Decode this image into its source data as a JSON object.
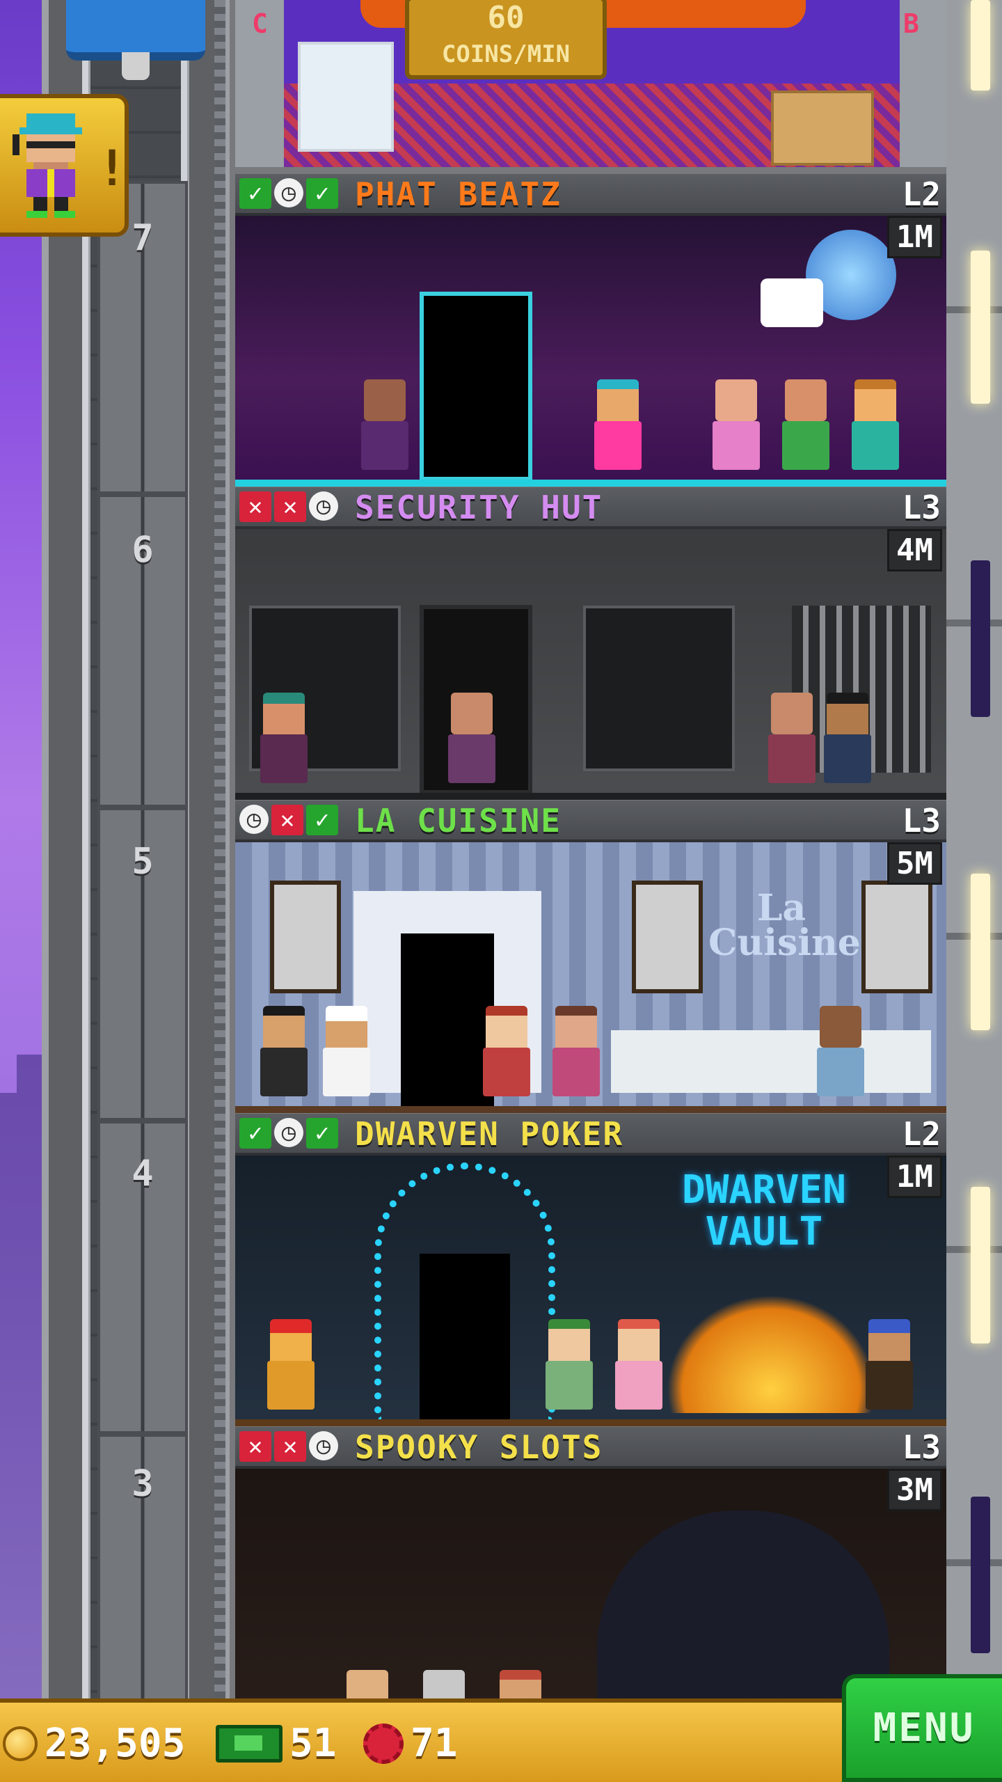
{
  "shaft": {
    "floor_numbers": [
      "7",
      "6",
      "5",
      "4",
      "3"
    ]
  },
  "top_floor": {
    "sign_value": "60",
    "sign_unit": "COINS/MIN",
    "corner_left": "C",
    "corner_right": "B"
  },
  "floors": [
    {
      "name": "PHAT BEATZ",
      "level": "L2",
      "population": "1M",
      "name_color": "#ff7a1a",
      "status": [
        "ok",
        "timer",
        "ok"
      ]
    },
    {
      "name": "SECURITY HUT",
      "level": "L3",
      "population": "4M",
      "name_color": "#d48cf0",
      "status": [
        "x",
        "x",
        "timer"
      ]
    },
    {
      "name": "LA CUISINE",
      "level": "L3",
      "population": "5M",
      "name_color": "#6ee04a",
      "status": [
        "timer",
        "x",
        "ok"
      ]
    },
    {
      "name": "DWARVEN POKER",
      "level": "L2",
      "population": "1M",
      "name_color": "#f4e04a",
      "status": [
        "ok",
        "timer",
        "ok"
      ]
    },
    {
      "name": "SPOOKY SLOTS",
      "level": "L3",
      "population": "3M",
      "name_color": "#f4e04a",
      "status": [
        "x",
        "x",
        "timer"
      ]
    }
  ],
  "room_signs": {
    "cuisine": "La Cuisine",
    "poker": "DWARVEN VAULT"
  },
  "bottom_bar": {
    "coins": "23,505",
    "bux": "51",
    "gear": "71",
    "menu_label": "MENU"
  },
  "icons": {
    "status_ok": "check-icon",
    "status_x": "x-icon",
    "status_timer": "clock-icon",
    "coins": "coin-icon",
    "bux": "bux-icon",
    "gear": "gear-icon"
  },
  "colors": {
    "ok": "#25a52e",
    "x": "#d8233b",
    "menu": "#1aa12c",
    "bar": "#e5ac2a"
  }
}
